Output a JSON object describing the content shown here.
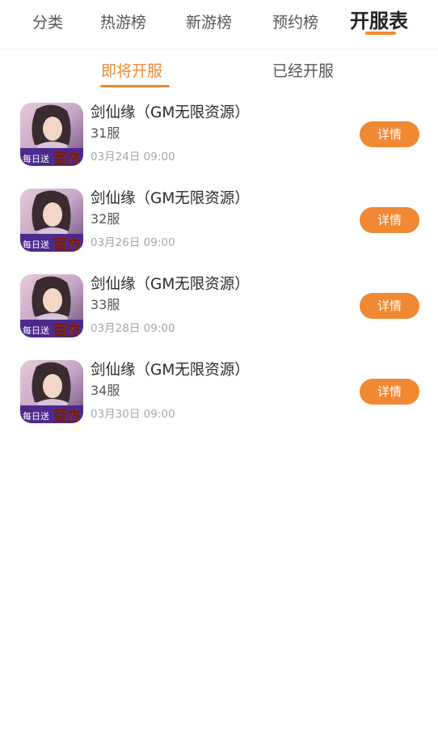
{
  "top_nav": {
    "tabs": [
      {
        "label": "分类"
      },
      {
        "label": "热游榜"
      },
      {
        "label": "新游榜"
      },
      {
        "label": "预约榜"
      },
      {
        "label": "开服表"
      }
    ],
    "active_tab": "开服表"
  },
  "sub_tabs": {
    "tabs": [
      {
        "label": "即将开服"
      },
      {
        "label": "已经开服"
      }
    ],
    "active_tab": "即将开服"
  },
  "games": [
    {
      "name": "剑仙缘（GM无限资源）",
      "server": "31服",
      "time": "03月24日 09:00",
      "detail_label": "详情",
      "icon_banner": "每日送百方"
    },
    {
      "name": "剑仙缘（GM无限资源）",
      "server": "32服",
      "time": "03月26日 09:00",
      "detail_label": "详情",
      "icon_banner": "每日送百方"
    },
    {
      "name": "剑仙缘（GM无限资源）",
      "server": "33服",
      "time": "03月28日 09:00",
      "detail_label": "详情",
      "icon_banner": "每日送百方"
    },
    {
      "name": "剑仙缘（GM无限资源）",
      "server": "34服",
      "time": "03月30日 09:00",
      "detail_label": "详情",
      "icon_banner": "每日送百方"
    }
  ],
  "colors": {
    "accent": "#ef8934",
    "text_primary": "#2b2b2b",
    "text_secondary": "#555555",
    "text_muted": "#a6a6a6"
  }
}
